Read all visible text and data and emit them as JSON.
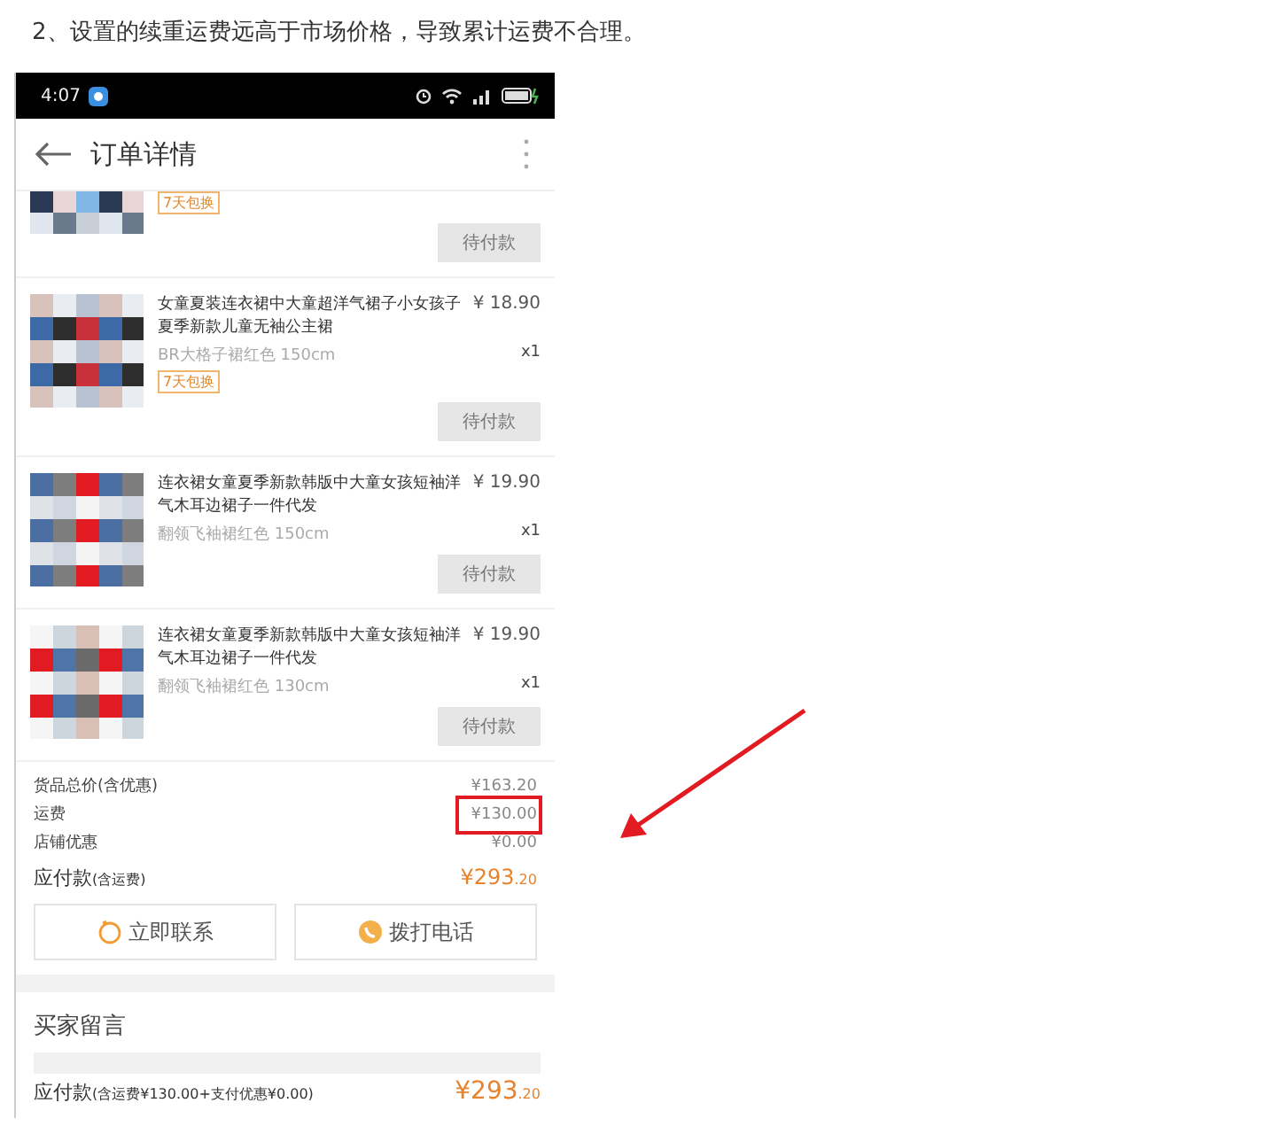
{
  "article": {
    "heading": "2、设置的续重运费远高于市场价格，导致累计运费不合理。"
  },
  "phone": {
    "status_bar": {
      "time": "4:07"
    },
    "header": {
      "title": "订单详情"
    },
    "items": [
      {
        "tag": "7天包换",
        "button": "待付款"
      },
      {
        "title": "女童夏装连衣裙中大童超洋气裙子小女孩子夏季新款儿童无袖公主裙",
        "price": "¥ 18.90",
        "spec": "BR大格子裙红色 150cm",
        "qty": "x1",
        "tag": "7天包换",
        "button": "待付款"
      },
      {
        "title": "连衣裙女童夏季新款韩版中大童女孩短袖洋气木耳边裙子一件代发",
        "price": "¥ 19.90",
        "spec": "翻领飞袖裙红色 150cm",
        "qty": "x1",
        "button": "待付款"
      },
      {
        "title": "连衣裙女童夏季新款韩版中大童女孩短袖洋气木耳边裙子一件代发",
        "price": "¥ 19.90",
        "spec": "翻领飞袖裙红色 130cm",
        "qty": "x1",
        "button": "待付款"
      }
    ],
    "summary": [
      {
        "label": "货品总价(含优惠)",
        "value": "¥163.20",
        "highlighted": false
      },
      {
        "label": "运费",
        "value": "¥130.00",
        "highlighted": true
      },
      {
        "label": "店铺优惠",
        "value": "¥0.00",
        "highlighted": false
      }
    ],
    "total": {
      "label": "应付款",
      "note": "(含运费)",
      "amount": "¥293",
      "decimals": ".20"
    },
    "contact_buttons": [
      {
        "label": "立即联系",
        "kind": "chat"
      },
      {
        "label": "拨打电话",
        "kind": "phone"
      }
    ],
    "buyer_note": {
      "title": "买家留言"
    },
    "footer": {
      "label": "应付款",
      "note": "(含运费¥130.00+支付优惠¥0.00)",
      "amount": "¥293",
      "decimals": ".20"
    }
  }
}
